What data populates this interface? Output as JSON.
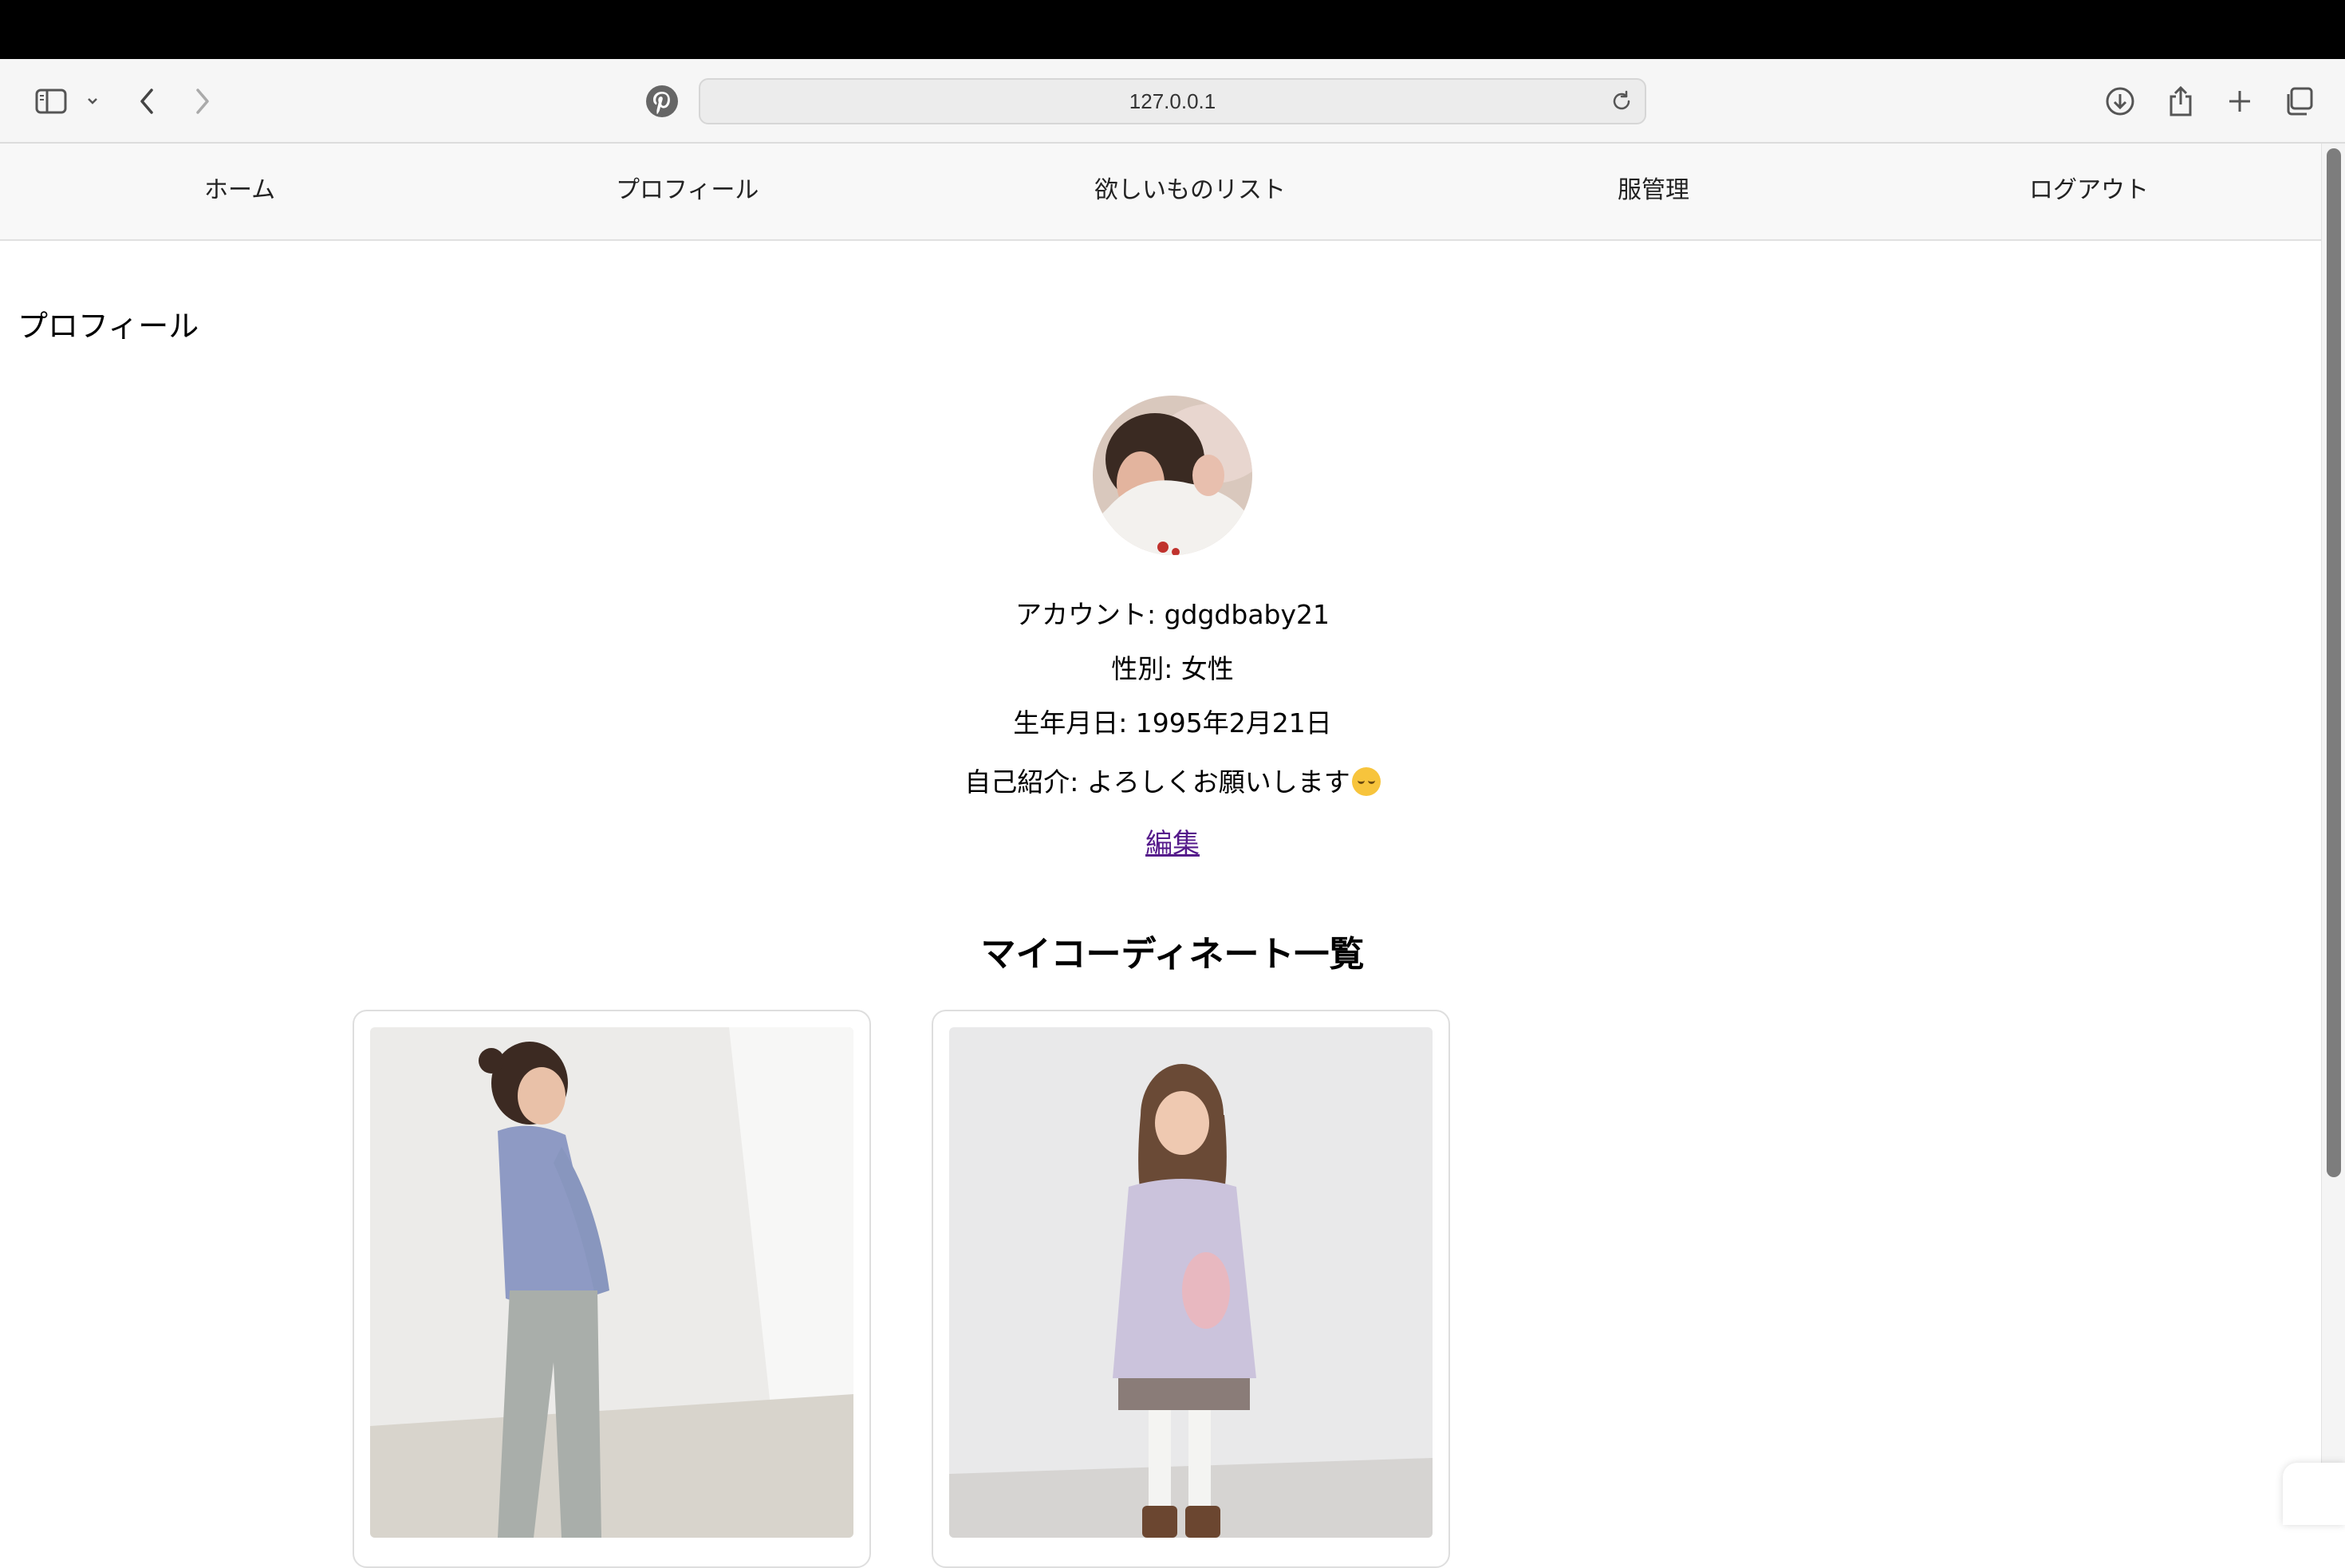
{
  "browser": {
    "url": "127.0.0.1",
    "icons": [
      "sidebar-icon",
      "chevron-down-icon",
      "back-arrow-icon",
      "forward-arrow-icon",
      "pinterest-icon",
      "reload-icon",
      "download-icon",
      "share-icon",
      "new-tab-icon",
      "tabs-overview-icon"
    ]
  },
  "nav": {
    "items": [
      "ホーム",
      "プロフィール",
      "欲しいものリスト",
      "服管理",
      "ログアウト"
    ]
  },
  "profile": {
    "heading": "プロフィール",
    "account": "アカウント: gdgdbaby21",
    "gender": "性別: 女性",
    "birthday": "生年月日: 1995年2月21日",
    "intro": "自己紹介: よろしくお願いします",
    "edit_label": "編集"
  },
  "coordinates": {
    "title": "マイコーディネート一覧"
  },
  "colors": {
    "menubar": "#000000",
    "toolbar": "#f6f6f6",
    "navbar": "#f8f8f8",
    "link": "#551a8b"
  }
}
